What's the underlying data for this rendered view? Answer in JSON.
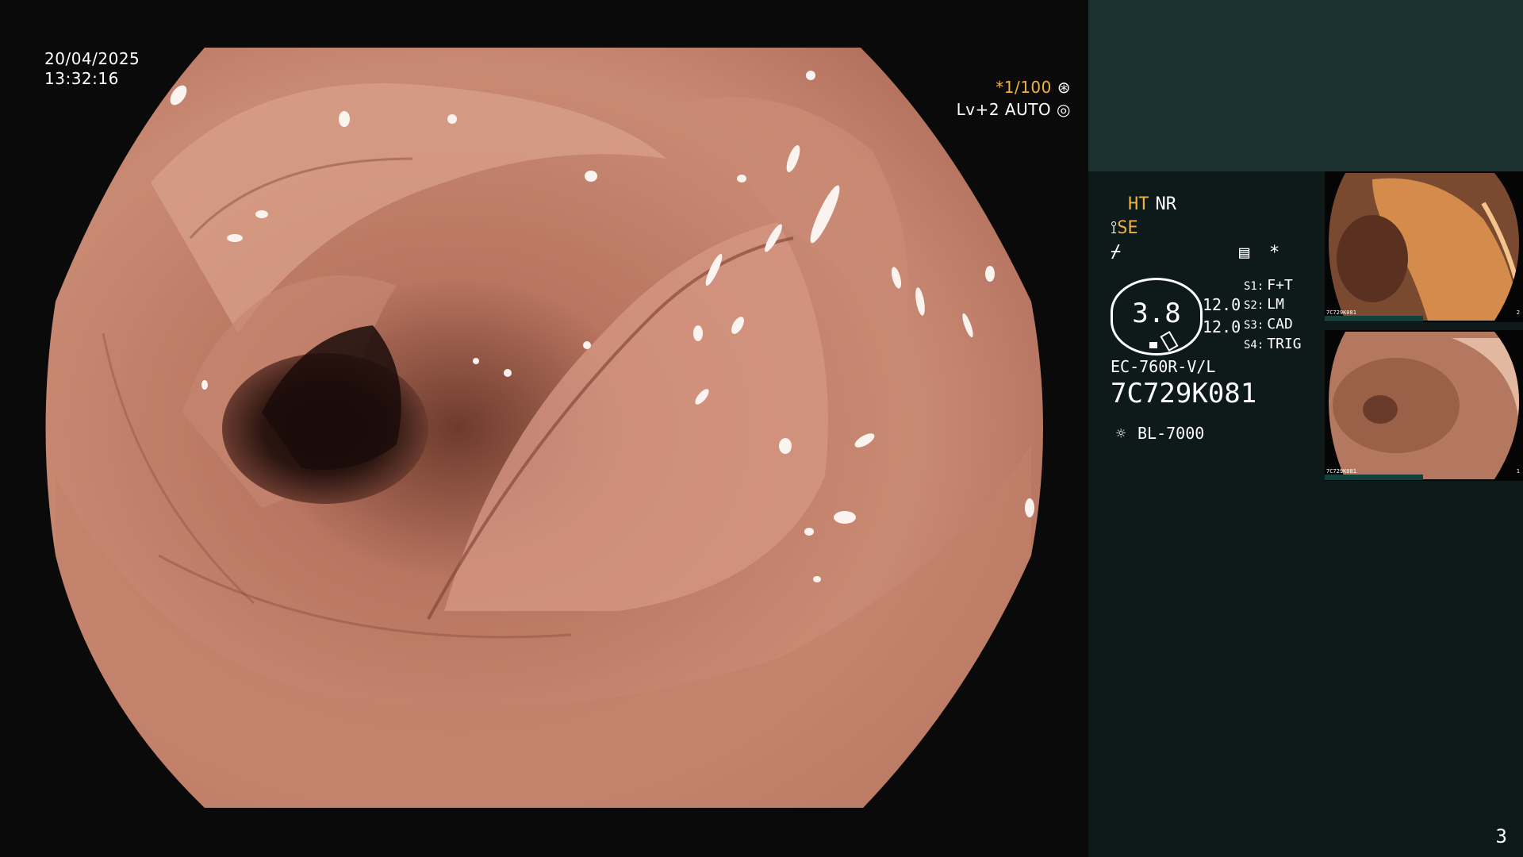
{
  "overlay": {
    "date": "20/04/2025",
    "time": "13:32:16",
    "shutter": "*1/100",
    "level": "Lv+2 AUTO"
  },
  "side": {
    "ht": "HT",
    "nr": "NR",
    "se": "SE",
    "oval_value": "3.8",
    "value_1": "12.0",
    "value_2": "12.0",
    "scene_1": {
      "key": "S1:",
      "label": "F+T"
    },
    "scene_2": {
      "key": "S2:",
      "label": "LM"
    },
    "scene_3": {
      "key": "S3:",
      "label": "CAD"
    },
    "scene_4": {
      "key": "S4:",
      "label": "TRIG"
    },
    "scope_model": "EC-760R-V/L",
    "serial": "7C729K081",
    "light_source": "BL-7000",
    "page_number": "3"
  },
  "thumbnails": [
    {
      "index": "2",
      "serial": "7C729K081"
    },
    {
      "index": "1",
      "serial": "7C729K081"
    }
  ],
  "icons": {
    "shutter": "shutter-icon",
    "auto": "auto-iris-icon",
    "structure": "structure-enhance-icon",
    "color": "color-enhance-icon",
    "menu": "menu-icon",
    "star": "star-icon",
    "light": "light-source-icon"
  }
}
